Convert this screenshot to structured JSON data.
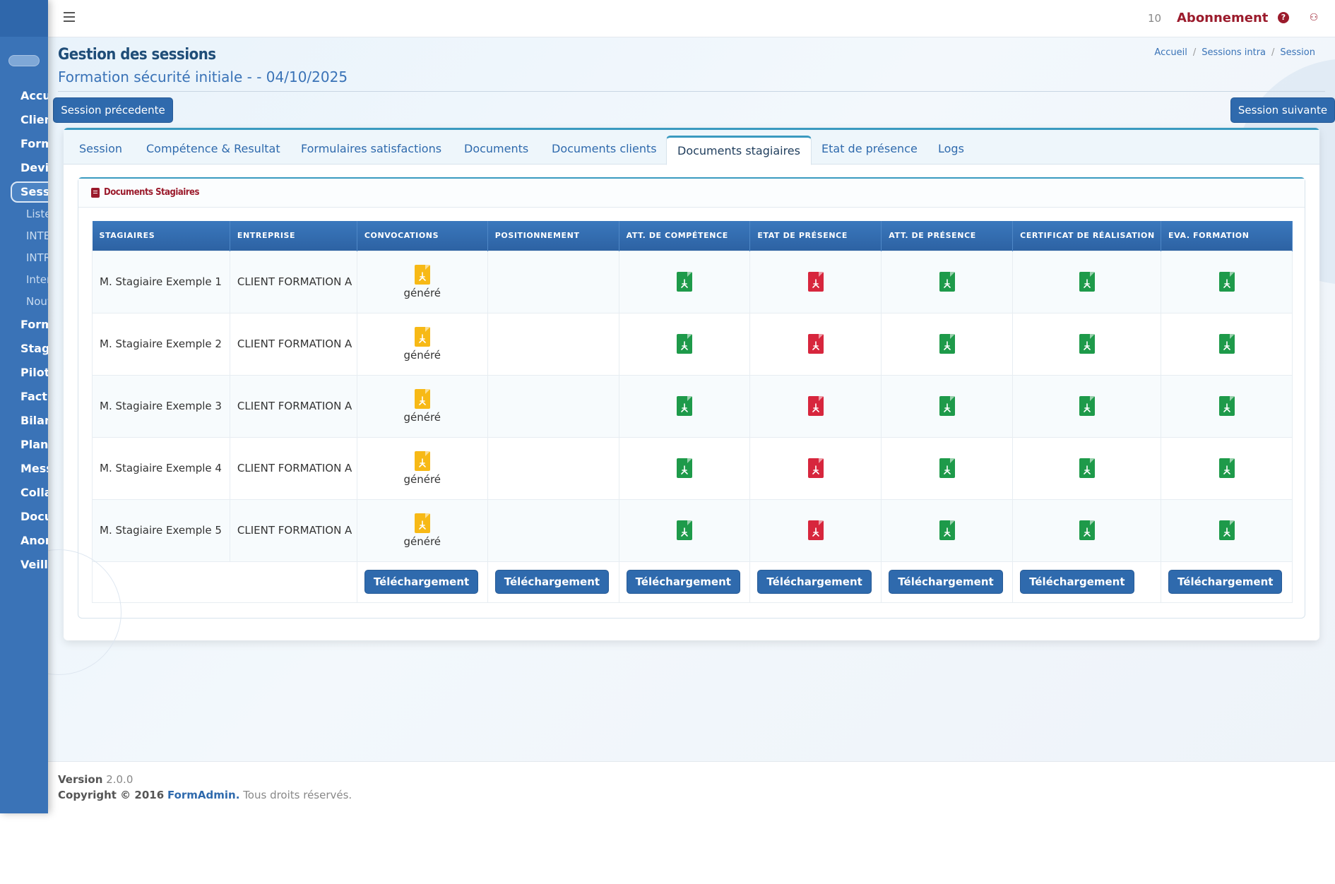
{
  "sidebar": {
    "items": [
      {
        "label": "Accueil"
      },
      {
        "label": "Clients"
      },
      {
        "label": "Formations"
      },
      {
        "label": "Devis"
      },
      {
        "label": "Sessions"
      },
      {
        "label": "Formulaires"
      },
      {
        "label": "Stagiaires"
      },
      {
        "label": "Pilotage"
      },
      {
        "label": "Factures"
      },
      {
        "label": "Bilan"
      },
      {
        "label": "Planning"
      },
      {
        "label": "Messages"
      },
      {
        "label": "Collaborateurs"
      },
      {
        "label": "Documents"
      },
      {
        "label": "Anomalies"
      },
      {
        "label": "Veille"
      }
    ],
    "sub_items": [
      {
        "label": "Liste"
      },
      {
        "label": "INTER"
      },
      {
        "label": "INTRA"
      },
      {
        "label": "Interne"
      },
      {
        "label": "Nouvelle"
      }
    ]
  },
  "topbar": {
    "count": "10",
    "subscription": "Abonnement",
    "help_glyph": "?",
    "user_glyph": "⚇"
  },
  "header": {
    "title": "Gestion des sessions",
    "subtitle": "Formation sécurité initiale - - 04/10/2025",
    "breadcrumb": [
      "Accueil",
      "Sessions intra",
      "Session"
    ]
  },
  "nav_buttons": {
    "prev": "Session précedente",
    "next": "Session suivante"
  },
  "tabs": [
    {
      "label": "Session"
    },
    {
      "label": "Compétence & Resultat"
    },
    {
      "label": "Formulaires satisfactions"
    },
    {
      "label": "Documents"
    },
    {
      "label": "Documents clients"
    },
    {
      "label": "Documents stagiaires",
      "active": true
    },
    {
      "label": "Etat de présence"
    },
    {
      "label": "Logs"
    }
  ],
  "panel": {
    "title": "Documents Stagiaires",
    "icon": "document-icon"
  },
  "table": {
    "headers": [
      "Stagiaires",
      "Entreprise",
      "Convocations",
      "Positionnement",
      "Att. de compétence",
      "Etat de présence",
      "Att. de présence",
      "Certificat de réalisation",
      "Eva. formation"
    ],
    "rows": [
      {
        "name": "M. Stagiaire Exemple 1",
        "company": "CLIENT FORMATION A",
        "convocation_status": "généré"
      },
      {
        "name": "M. Stagiaire Exemple 2",
        "company": "CLIENT FORMATION A",
        "convocation_status": "généré"
      },
      {
        "name": "M. Stagiaire Exemple 3",
        "company": "CLIENT FORMATION A",
        "convocation_status": "généré"
      },
      {
        "name": "M. Stagiaire Exemple 4",
        "company": "CLIENT FORMATION A",
        "convocation_status": "généré"
      },
      {
        "name": "M. Stagiaire Exemple 5",
        "company": "CLIENT FORMATION A",
        "convocation_status": "généré"
      }
    ],
    "download_label": "Téléchargement",
    "icon_colors": {
      "convocation": "#f7b916",
      "competence": "#1e9a4a",
      "etat_presence": "#d7263d",
      "att_presence": "#1e9a4a",
      "certificat": "#1e9a4a",
      "evaluation": "#1e9a4a"
    }
  },
  "footer": {
    "version_label": "Version",
    "version": "2.0.0",
    "copyright": "Copyright © 2016",
    "brand": "FormAdmin.",
    "rights": "Tous droits réservés."
  }
}
